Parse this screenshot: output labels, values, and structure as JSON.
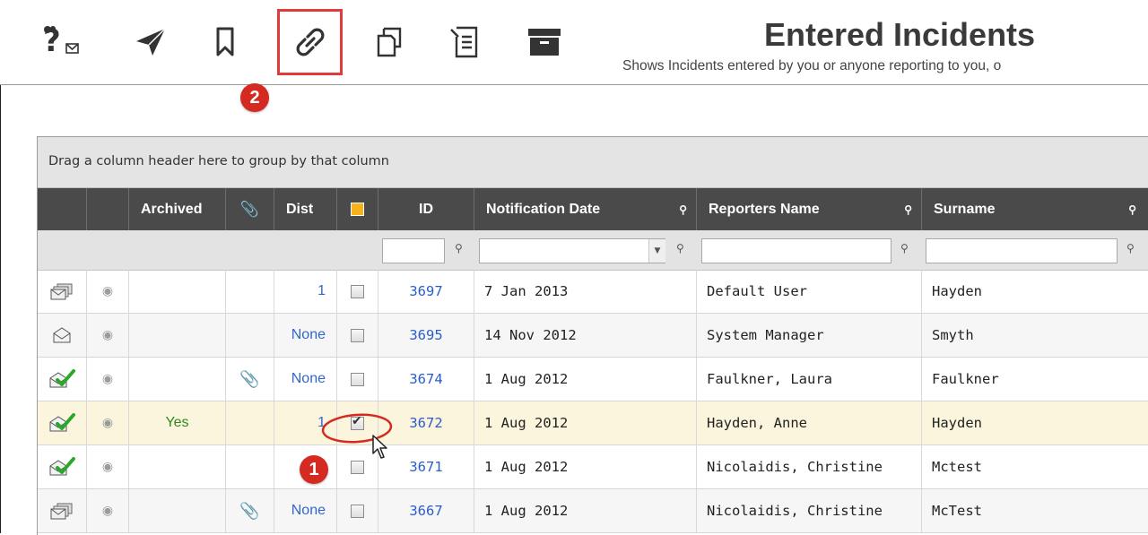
{
  "header": {
    "title": "Entered Incidents",
    "subtitle": "Shows Incidents entered by you or anyone reporting to you, o"
  },
  "toolbar": {
    "buttons": [
      {
        "name": "help-mail-icon"
      },
      {
        "name": "send-icon"
      },
      {
        "name": "bookmark-icon"
      },
      {
        "name": "link-icon"
      },
      {
        "name": "copy-icon"
      },
      {
        "name": "document-icon"
      },
      {
        "name": "archive-icon"
      }
    ]
  },
  "callouts": {
    "one": "1",
    "two": "2"
  },
  "grid": {
    "group_hint": "Drag a column header here to group by that column",
    "columns": {
      "archived": "Archived",
      "dist": "Dist",
      "id": "ID",
      "notification_date": "Notification Date",
      "reporters_name": "Reporters Name",
      "surname": "Surname"
    },
    "rows": [
      {
        "mail": "mail-stack-icon",
        "archived": "",
        "attach": false,
        "dist": "1",
        "checked": false,
        "id": "3697",
        "date": "7 Jan 2013",
        "reporter": "Default User",
        "surname": "Hayden"
      },
      {
        "mail": "mail-open-icon",
        "archived": "",
        "attach": false,
        "dist": "None",
        "checked": false,
        "id": "3695",
        "date": "14 Nov 2012",
        "reporter": "System Manager",
        "surname": "Smyth"
      },
      {
        "mail": "mail-check-icon",
        "archived": "",
        "attach": true,
        "dist": "None",
        "checked": false,
        "id": "3674",
        "date": "1 Aug 2012",
        "reporter": "Faulkner, Laura",
        "surname": "Faulkner"
      },
      {
        "mail": "mail-check-icon",
        "archived": "Yes",
        "attach": false,
        "dist": "1",
        "checked": true,
        "id": "3672",
        "date": "1 Aug 2012",
        "reporter": "Hayden, Anne",
        "surname": "Hayden"
      },
      {
        "mail": "mail-check-icon",
        "archived": "",
        "attach": false,
        "dist": "N",
        "checked": false,
        "id": "3671",
        "date": "1 Aug 2012",
        "reporter": "Nicolaidis, Christine",
        "surname": "Mctest"
      },
      {
        "mail": "mail-stack-icon",
        "archived": "",
        "attach": true,
        "dist": "None",
        "checked": false,
        "id": "3667",
        "date": "1 Aug 2012",
        "reporter": "Nicolaidis, Christine",
        "surname": "McTest"
      }
    ]
  },
  "colors": {
    "header_bg": "#4a4a4a",
    "callout_red": "#d42a22",
    "link_blue": "#2a5dc9",
    "selected_row": "#fbf5dd",
    "yes_green": "#2e8a1e"
  }
}
